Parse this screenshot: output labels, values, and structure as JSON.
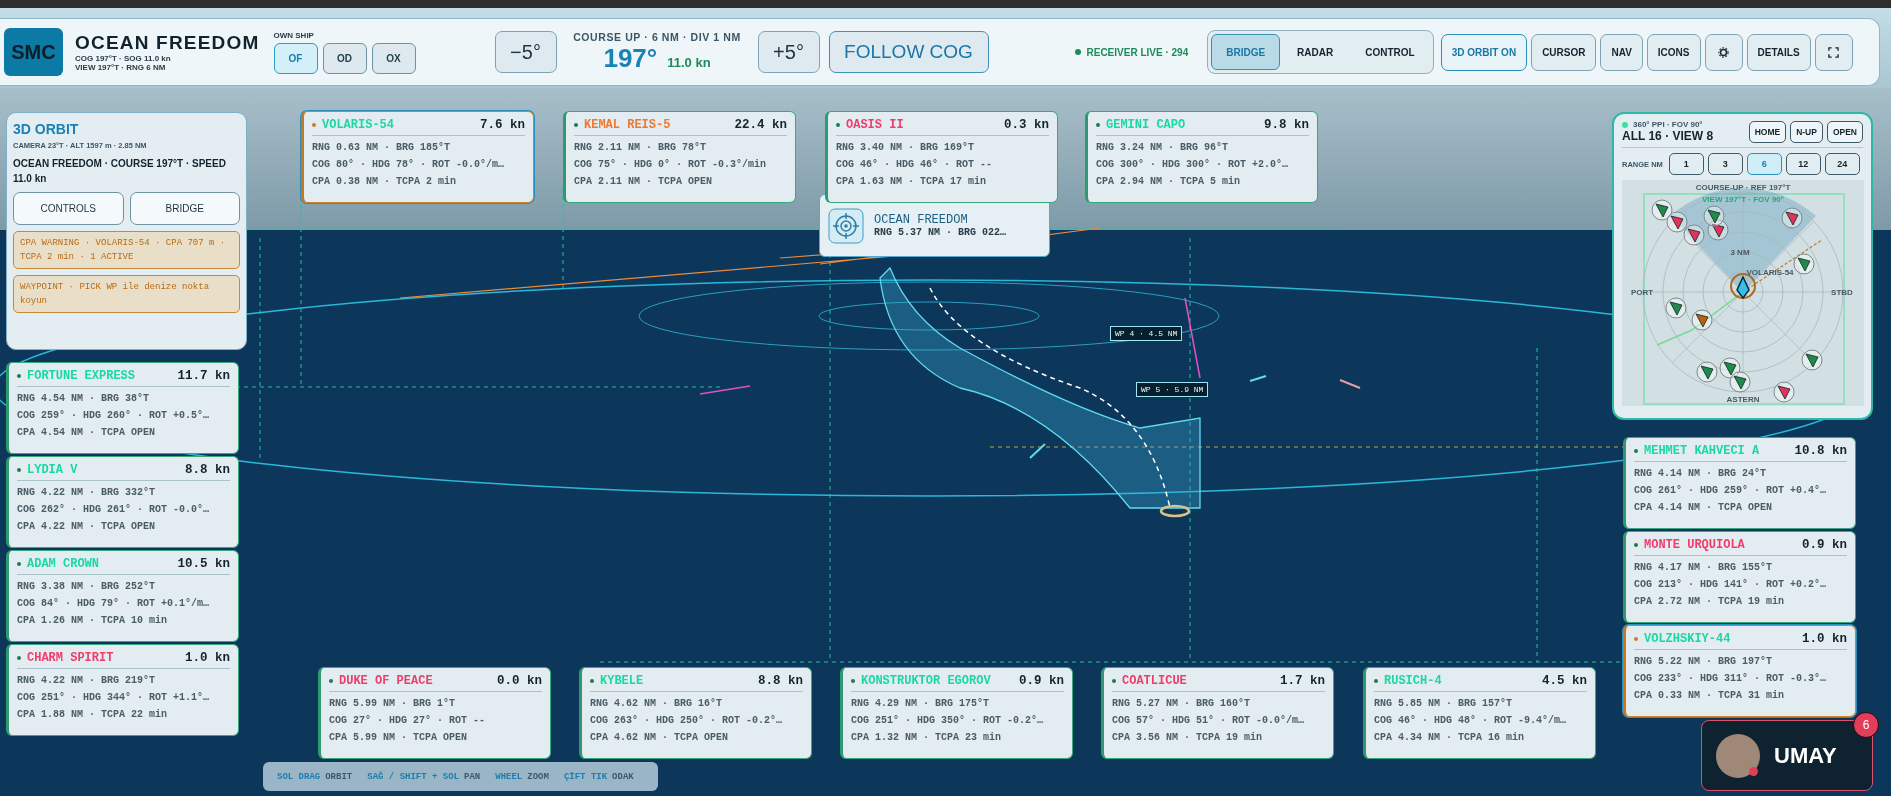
{
  "top_bar": {
    "logo": "SMC",
    "ship_name": "OCEAN FREEDOM",
    "ship_line_1": "COG 197°T · SOG 11.0 kn",
    "ship_line_2": "VIEW 197°T · RNG 6 NM",
    "own_ship_label": "OWN SHIP",
    "own_ships": [
      {
        "label": "OF",
        "selected": true
      },
      {
        "label": "OD",
        "selected": false
      },
      {
        "label": "OX",
        "selected": false
      }
    ],
    "rotate_left": "−5°",
    "course_mode": "COURSE UP · 6 NM · DIV 1 NM",
    "heading": "197°",
    "speed": "11.0 kn",
    "rotate_right": "+5°",
    "follow": "FOLLOW COG",
    "receiver": "RECEIVER LIVE · 294",
    "views": [
      {
        "label": "BRIDGE",
        "selected": true
      },
      {
        "label": "RADAR",
        "selected": false
      },
      {
        "label": "CONTROL",
        "selected": false
      }
    ],
    "tools": [
      {
        "kind": "text",
        "label": "3D ORBIT ON",
        "on": true
      },
      {
        "kind": "text",
        "label": "CURSOR",
        "on": false
      },
      {
        "kind": "text",
        "label": "NAV",
        "on": false
      },
      {
        "kind": "text",
        "label": "ICONS",
        "on": false
      },
      {
        "kind": "settings",
        "on": false
      },
      {
        "kind": "text",
        "label": "DETAILS",
        "on": false
      },
      {
        "kind": "fullscreen",
        "on": false
      }
    ]
  },
  "orbit_panel": {
    "title": "3D ORBIT",
    "camera": "CAMERA 23°T · ALT 1597 m · 2.85 NM",
    "summary": "OCEAN FREEDOM · COURSE 197°T · SPEED 11.0 kn",
    "buttons": [
      "CONTROLS",
      "BRIDGE"
    ],
    "notices": [
      "CPA WARNING · VOLARIS-54 · CPA 707 m · TCPA 2 min · 1 ACTIVE",
      "WAYPOINT · PICK WP ile denize nokta koyun"
    ]
  },
  "focus_popup": {
    "name": "OCEAN FREEDOM",
    "detail": "RNG 5.37 NM · BRG 022…"
  },
  "scene_labels": [
    "WP 4 · 4.5 NM",
    "WP 5 · 5.9 NM"
  ],
  "targets_top": [
    {
      "name": "VOLARIS-54",
      "color": "#19d9a0",
      "speed": "7.6 kn",
      "rng": "RNG 0.63 NM · BRG 185°T",
      "cog": "COG 80° · HDG 78° · ROT -0.0°/m…",
      "cpa": "CPA 0.38 NM · TCPA 2 min",
      "alert": true
    },
    {
      "name": "KEMAL REIS-5",
      "color": "#f0782a",
      "speed": "22.4 kn",
      "rng": "RNG 2.11 NM · BRG 78°T",
      "cog": "COG 75° · HDG 0° · ROT -0.3°/min",
      "cpa": "CPA 2.11 NM · TCPA OPEN",
      "alert": false
    },
    {
      "name": "OASIS II",
      "color": "#ee3d6c",
      "speed": "0.3 kn",
      "rng": "RNG 3.40 NM · BRG 169°T",
      "cog": "COG 46° · HDG 46° · ROT --",
      "cpa": "CPA 1.63 NM · TCPA 17 min",
      "alert": false
    },
    {
      "name": "GEMINI CAPO",
      "color": "#19d9a0",
      "speed": "9.8 kn",
      "rng": "RNG 3.24 NM · BRG 96°T",
      "cog": "COG 300° · HDG 300° · ROT +2.0°…",
      "cpa": "CPA 2.94 NM · TCPA 5 min",
      "alert": false
    }
  ],
  "targets_left": [
    {
      "name": "FORTUNE EXPRESS",
      "color": "#19d9a0",
      "speed": "11.7 kn",
      "rng": "RNG 4.54 NM · BRG 38°T",
      "cog": "COG 259° · HDG 260° · ROT +0.5°…",
      "cpa": "CPA 4.54 NM · TCPA OPEN",
      "alert": false
    },
    {
      "name": "LYDIA V",
      "color": "#19d9a0",
      "speed": "8.8 kn",
      "rng": "RNG 4.22 NM · BRG 332°T",
      "cog": "COG 262° · HDG 261° · ROT -0.0°…",
      "cpa": "CPA 4.22 NM · TCPA OPEN",
      "alert": false
    },
    {
      "name": "ADAM CROWN",
      "color": "#19d9a0",
      "speed": "10.5 kn",
      "rng": "RNG 3.38 NM · BRG 252°T",
      "cog": "COG 84° · HDG 79° · ROT +0.1°/m…",
      "cpa": "CPA 1.26 NM · TCPA 10 min",
      "alert": false
    },
    {
      "name": "CHARM SPIRIT",
      "color": "#ee3d6c",
      "speed": "1.0 kn",
      "rng": "RNG 4.22 NM · BRG 219°T",
      "cog": "COG 251° · HDG 344° · ROT +1.1°…",
      "cpa": "CPA 1.88 NM · TCPA 22 min",
      "alert": false
    }
  ],
  "targets_right": [
    {
      "name": "MEHMET KAHVECI A",
      "color": "#19d9a0",
      "speed": "10.8 kn",
      "rng": "RNG 4.14 NM · BRG 24°T",
      "cog": "COG 261° · HDG 259° · ROT +0.4°…",
      "cpa": "CPA 4.14 NM · TCPA OPEN",
      "alert": false
    },
    {
      "name": "MONTE URQUIOLA",
      "color": "#ee3d6c",
      "speed": "0.9 kn",
      "rng": "RNG 4.17 NM · BRG 155°T",
      "cog": "COG 213° · HDG 141° · ROT +0.2°…",
      "cpa": "CPA 2.72 NM · TCPA 19 min",
      "alert": false
    },
    {
      "name": "VOLZHSKIY-44",
      "color": "#19d9a0",
      "speed": "1.0 kn",
      "rng": "RNG 5.22 NM · BRG 197°T",
      "cog": "COG 233° · HDG 311° · ROT -0.3°…",
      "cpa": "CPA 0.33 NM · TCPA 31 min",
      "alert": true
    }
  ],
  "targets_bottom": [
    {
      "name": "DUKE OF PEACE",
      "color": "#ee3d6c",
      "speed": "0.0 kn",
      "rng": "RNG 5.99 NM · BRG 1°T",
      "cog": "COG 27° · HDG 27° · ROT --",
      "cpa": "CPA 5.99 NM · TCPA OPEN",
      "alert": false
    },
    {
      "name": "KYBELE",
      "color": "#19d9a0",
      "speed": "8.8 kn",
      "rng": "RNG 4.62 NM · BRG 16°T",
      "cog": "COG 263° · HDG 250° · ROT -0.2°…",
      "cpa": "CPA 4.62 NM · TCPA OPEN",
      "alert": false
    },
    {
      "name": "KONSTRUKTOR EGOROV",
      "color": "#19d9a0",
      "speed": "0.9 kn",
      "rng": "RNG 4.29 NM · BRG 175°T",
      "cog": "COG 251° · HDG 350° · ROT -0.2°…",
      "cpa": "CPA 1.32 NM · TCPA 23 min",
      "alert": false
    },
    {
      "name": "COATLICUE",
      "color": "#ee3d6c",
      "speed": "1.7 kn",
      "rng": "RNG 5.27 NM · BRG 160°T",
      "cog": "COG 57° · HDG 51° · ROT -0.0°/m…",
      "cpa": "CPA 3.56 NM · TCPA 19 min",
      "alert": false
    },
    {
      "name": "RUSICH-4",
      "color": "#19d9a0",
      "speed": "4.5 kn",
      "rng": "RNG 5.85 NM · BRG 157°T",
      "cog": "COG 46° · HDG 48° · ROT -9.4°/m…",
      "cpa": "CPA 4.34 NM · TCPA 16 min",
      "alert": false
    }
  ],
  "radar": {
    "mode": "360° PPI · FOV 90°",
    "count": "ALL 16 · VIEW 8",
    "buttons": [
      "HOME",
      "N-UP",
      "OPEN"
    ],
    "range_label": "RANGE NM",
    "ranges": [
      {
        "label": "1",
        "selected": false
      },
      {
        "label": "3",
        "selected": false
      },
      {
        "label": "6",
        "selected": true
      },
      {
        "label": "12",
        "selected": false
      },
      {
        "label": "24",
        "selected": false
      }
    ],
    "ref": "COURSE-UP · REF 197°T",
    "view": "VIEW 197°T · FOV 90°",
    "ring_label": "3 NM",
    "target_label": "VOLARIS-54",
    "port": "PORT",
    "stbd": "STBD",
    "astern": "ASTERN"
  },
  "hints": [
    {
      "keys": "SOL DRAG",
      "action": "ORBIT"
    },
    {
      "keys": "SAĞ / SHIFT + SOL",
      "action": "PAN"
    },
    {
      "keys": "WHEEL",
      "action": "ZOOM"
    },
    {
      "keys": "ÇİFT TIK",
      "action": "ODAK"
    }
  ],
  "user": {
    "name": "UMAY",
    "notifications": "6"
  }
}
